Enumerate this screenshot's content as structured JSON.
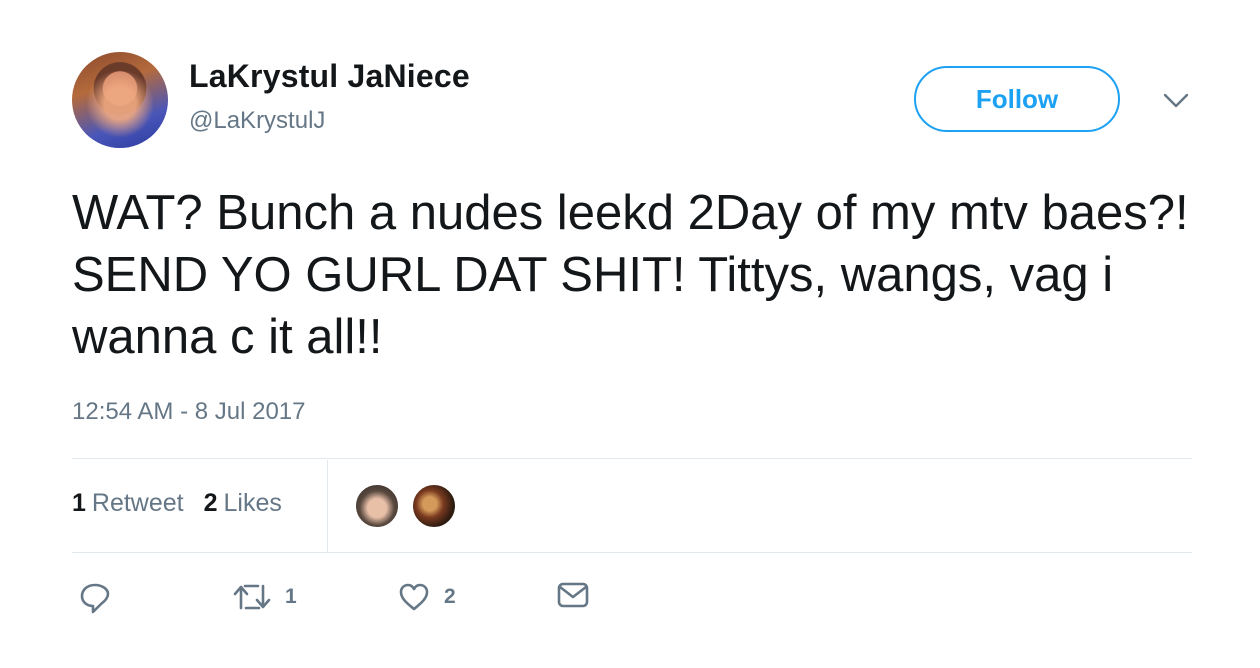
{
  "author": {
    "display_name": "LaKrystul JaNiece",
    "handle": "@LaKrystulJ"
  },
  "follow_label": "Follow",
  "tweet": {
    "text": "WAT? Bunch a nudes leekd 2Day of my mtv baes?! SEND YO GURL DAT SHIT! Tittys, wangs, vag i wanna c it all!!",
    "timestamp": "12:54 AM - 8 Jul 2017"
  },
  "stats": {
    "retweets_count": "1",
    "retweets_label": "Retweet",
    "likes_count": "2",
    "likes_label": "Likes"
  },
  "actions": {
    "reply": {
      "icon": "reply-icon"
    },
    "retweet": {
      "icon": "retweet-icon",
      "count": "1"
    },
    "like": {
      "icon": "heart-icon",
      "count": "2"
    },
    "dm": {
      "icon": "envelope-icon"
    }
  },
  "colors": {
    "accent": "#1da1f2",
    "text": "#14171a",
    "muted": "#657786",
    "divider": "#e1e8ed"
  }
}
